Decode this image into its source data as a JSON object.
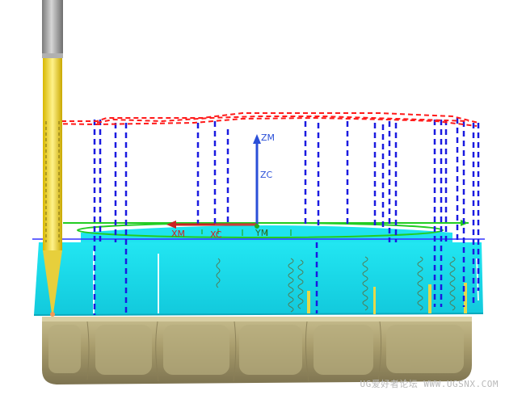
{
  "viewport": {
    "axes": {
      "zm": "ZM",
      "zc": "ZC",
      "xm": "XM",
      "xc": "XC",
      "ym": "YM"
    },
    "colors": {
      "background": "#ffffff",
      "toolpath_cut": "#1a1ae0",
      "toolpath_rapid": "#ff1a1a",
      "blank_surface": "#19e0f0",
      "part_body": "#a89c6c",
      "tool_holder": "#f2d640",
      "tool_shank": "#9a9a9a",
      "plane_green": "#22cc22"
    },
    "objects": [
      "tool-icon",
      "workpiece-icon",
      "toolpath-icon",
      "wcs-icon"
    ]
  },
  "watermark": {
    "text": "UG爱好者论坛 WWW.UGSNX.COM"
  }
}
